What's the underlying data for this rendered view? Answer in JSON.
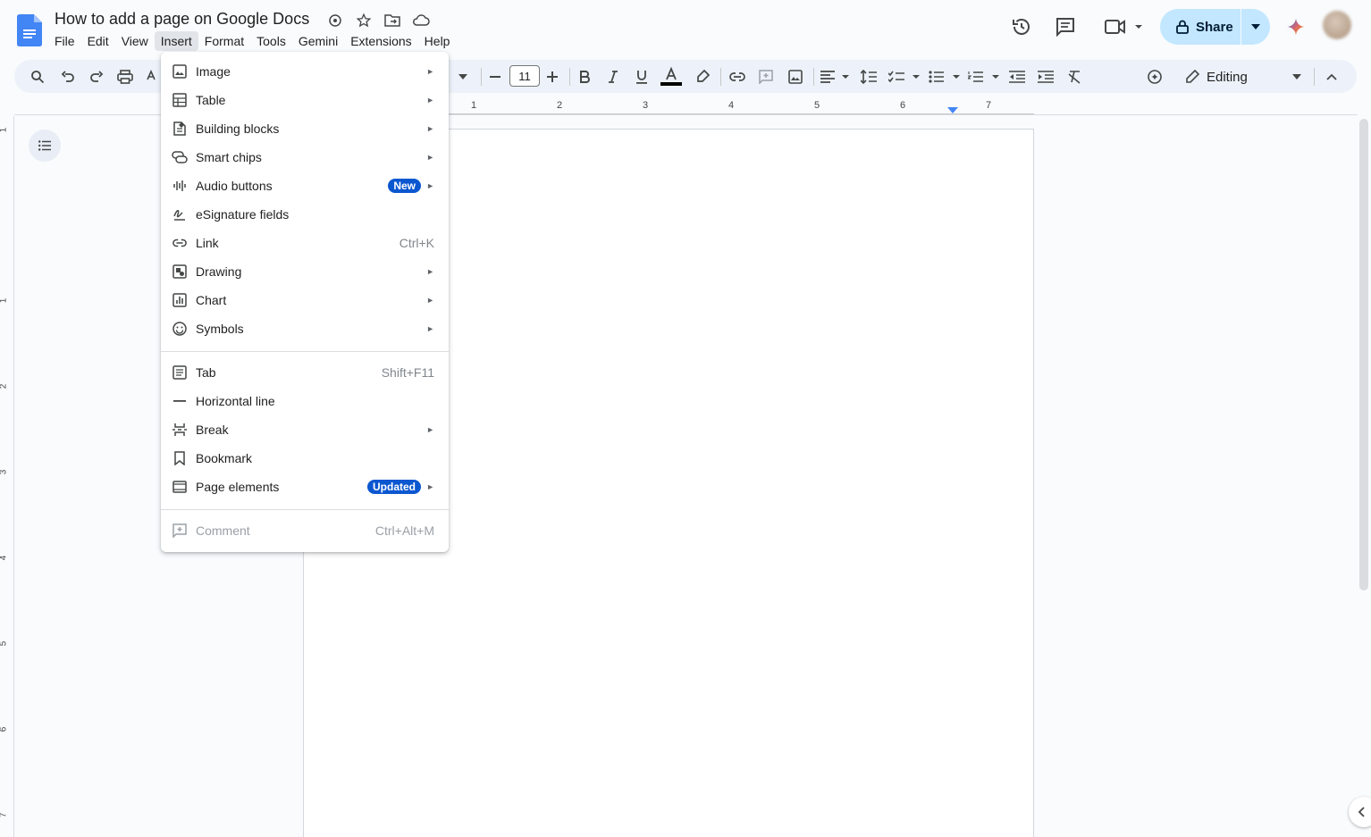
{
  "doc": {
    "title": "How to add a page on Google Docs"
  },
  "menubar": {
    "items": [
      "File",
      "Edit",
      "View",
      "Insert",
      "Format",
      "Tools",
      "Gemini",
      "Extensions",
      "Help"
    ],
    "active": "Insert"
  },
  "header": {
    "share_label": "Share"
  },
  "toolbar": {
    "font_size": "11",
    "mode_label": "Editing"
  },
  "ruler": {
    "marks": [
      "1",
      "2",
      "3",
      "4",
      "5",
      "6",
      "7"
    ]
  },
  "vruler": {
    "marks": [
      "1",
      "1",
      "2",
      "3",
      "4",
      "5",
      "6",
      "7"
    ]
  },
  "insert_menu": {
    "items": [
      {
        "label": "Image",
        "icon": "image-icon",
        "submenu": true
      },
      {
        "label": "Table",
        "icon": "table-icon",
        "submenu": true
      },
      {
        "label": "Building blocks",
        "icon": "building-blocks-icon",
        "submenu": true
      },
      {
        "label": "Smart chips",
        "icon": "smart-chips-icon",
        "submenu": true
      },
      {
        "label": "Audio buttons",
        "icon": "audio-icon",
        "submenu": true,
        "badge": "New"
      },
      {
        "label": "eSignature fields",
        "icon": "signature-icon",
        "submenu": false
      },
      {
        "label": "Link",
        "icon": "link-icon",
        "shortcut": "Ctrl+K"
      },
      {
        "label": "Drawing",
        "icon": "drawing-icon",
        "submenu": true
      },
      {
        "label": "Chart",
        "icon": "chart-icon",
        "submenu": true
      },
      {
        "label": "Symbols",
        "icon": "symbols-icon",
        "submenu": true
      },
      {
        "label": "Tab",
        "icon": "tab-icon",
        "shortcut": "Shift+F11"
      },
      {
        "label": "Horizontal line",
        "icon": "horizontal-line-icon"
      },
      {
        "label": "Break",
        "icon": "break-icon",
        "submenu": true
      },
      {
        "label": "Bookmark",
        "icon": "bookmark-icon"
      },
      {
        "label": "Page elements",
        "icon": "page-elements-icon",
        "submenu": true,
        "badge": "Updated"
      },
      {
        "label": "Comment",
        "icon": "comment-add-icon",
        "shortcut": "Ctrl+Alt+M",
        "disabled": true
      }
    ]
  },
  "colors": {
    "accent": "#0b57d0",
    "share_bg": "#c2e7ff",
    "toolbar_bg": "#edf2fa",
    "page_bg": "#f9fbfd"
  }
}
